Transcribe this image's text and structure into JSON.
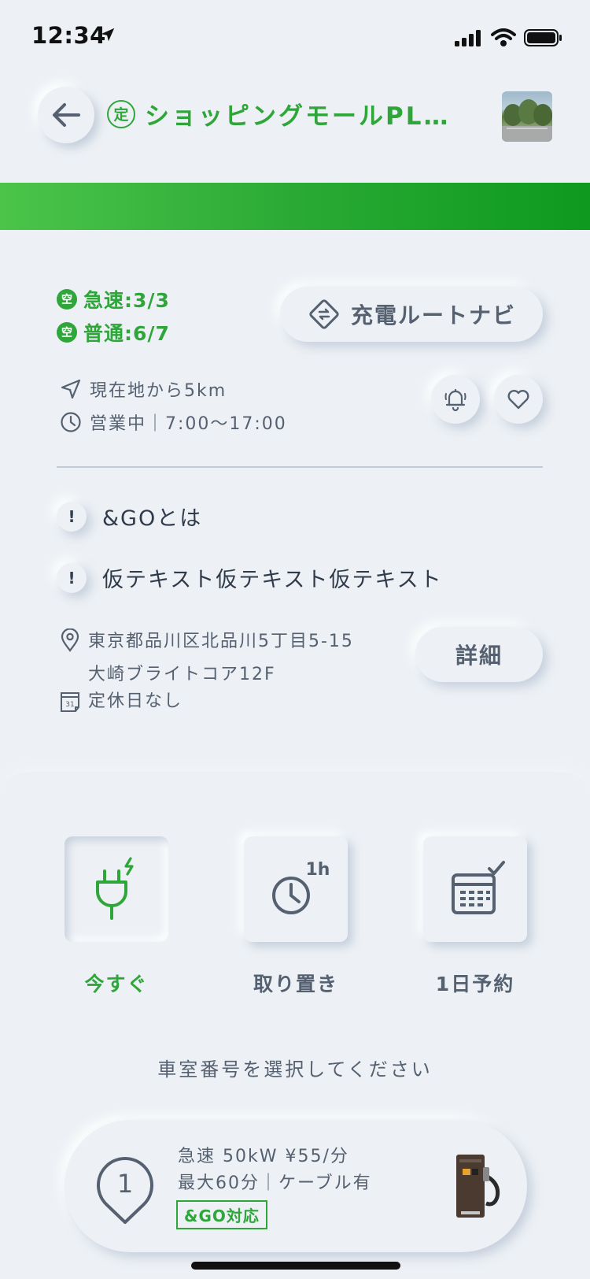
{
  "status_bar": {
    "time": "12:34"
  },
  "header": {
    "badge": "定",
    "title": "ショッピングモールPL…"
  },
  "availability": {
    "badge": "空",
    "rapid": "急速:3/3",
    "normal": "普通:6/7"
  },
  "route_button": {
    "label": "充電ルートナビ"
  },
  "info": {
    "distance": "現在地から5km",
    "hours": "営業中｜7:00～17:00"
  },
  "notices": [
    {
      "mark": "!",
      "text": "&GOとは"
    },
    {
      "mark": "!",
      "text": "仮テキスト仮テキスト仮テキスト"
    }
  ],
  "address": {
    "line1": "東京都品川区北品川5丁目5-15",
    "line2": "大崎ブライトコア12F",
    "holiday": "定休日なし",
    "calendar_day": "31"
  },
  "detail_button": {
    "label": "詳細"
  },
  "modes": [
    {
      "label": "今すぐ",
      "icon": "plug-icon",
      "selected": true
    },
    {
      "label": "取り置き",
      "icon": "clock-1h-icon",
      "badge": "1h",
      "selected": false
    },
    {
      "label": "1日予約",
      "icon": "calendar-check-icon",
      "selected": false
    }
  ],
  "select_prompt": "車室番号を選択してください",
  "charger": {
    "number": "1",
    "spec_line1": "急速 50kW ¥55/分",
    "spec_line2": "最大60分｜ケーブル有",
    "tag": "&GO対応"
  },
  "colors": {
    "accent_green": "#2fa63a",
    "background": "#edf1f5",
    "text_gray": "#556070"
  }
}
